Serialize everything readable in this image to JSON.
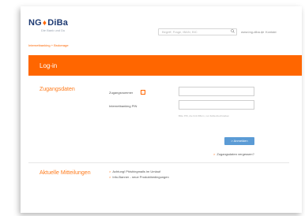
{
  "brand": {
    "name_left": "NG",
    "name_right": "DiBa",
    "lion_icon": "lion-icon",
    "tagline": "Die Bank und Du"
  },
  "header": {
    "search_placeholder": "Begriff, Frage, IBAN, BIC",
    "links": [
      "www.ing-diba.de",
      "Kontakt"
    ],
    "separator": "|"
  },
  "breadcrumb": "Internetbanking + Brokerage",
  "banner": {
    "title": "Log-in"
  },
  "login": {
    "section_title": "Zugangsdaten",
    "account_label": "Zugangsnummer",
    "help_glyph": "i",
    "pin_label": "Internetbanking PIN",
    "hint": "Bitte PIN, die fünf Ziffern, nur Zahlenbuchstaben",
    "submit_label": "> Anmelden",
    "forgot_arrow": ">",
    "forgot_label": "Zugangsdaten vergessen?"
  },
  "news": {
    "section_title": "Aktuelle Mitteilungen",
    "arrow": ">",
    "items": [
      "Achtung! Phishingmails im Umlauf",
      "Info-Banner - neue Produktbedingungen"
    ]
  },
  "colors": {
    "accent": "#ff6600",
    "button": "#5b9bd5",
    "brand_blue": "#1f3b73"
  }
}
